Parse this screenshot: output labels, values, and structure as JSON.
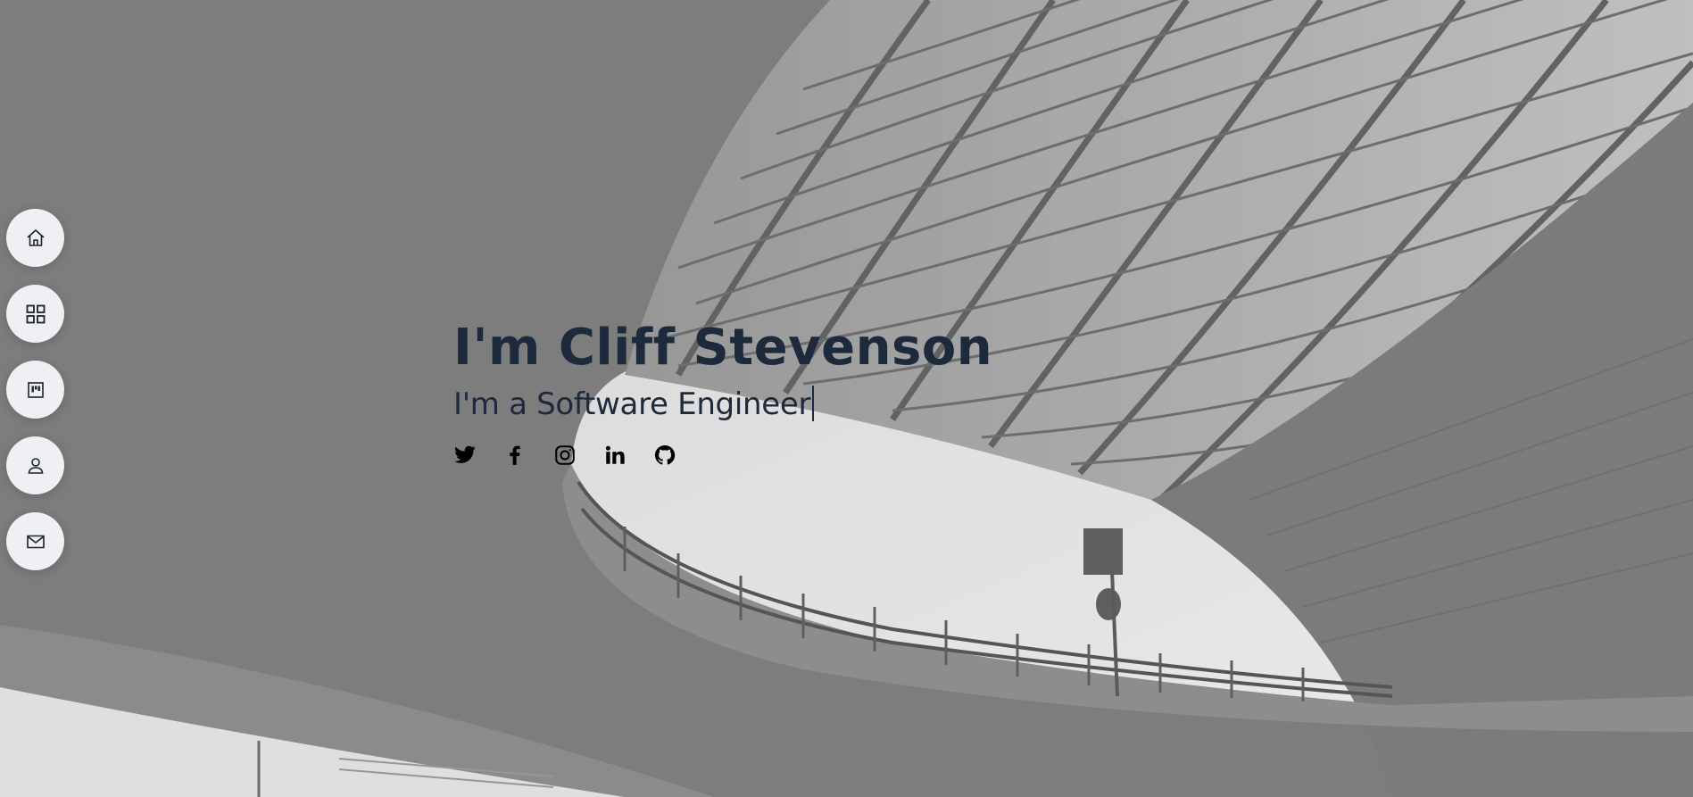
{
  "hero": {
    "name": "I'm Cliff Stevenson",
    "tagline": "I'm a Software Engineer"
  },
  "nav": {
    "items": [
      {
        "icon": "home-icon"
      },
      {
        "icon": "grid-icon"
      },
      {
        "icon": "kanban-icon"
      },
      {
        "icon": "user-icon"
      },
      {
        "icon": "envelope-icon"
      }
    ]
  },
  "socials": {
    "items": [
      {
        "icon": "twitter-icon"
      },
      {
        "icon": "facebook-icon"
      },
      {
        "icon": "instagram-icon"
      },
      {
        "icon": "linkedin-icon"
      },
      {
        "icon": "github-icon"
      }
    ]
  },
  "colors": {
    "text": "#1d2a3b",
    "nav_button_bg": "#eef0f3",
    "photo_tint": "#8a8a8a"
  }
}
